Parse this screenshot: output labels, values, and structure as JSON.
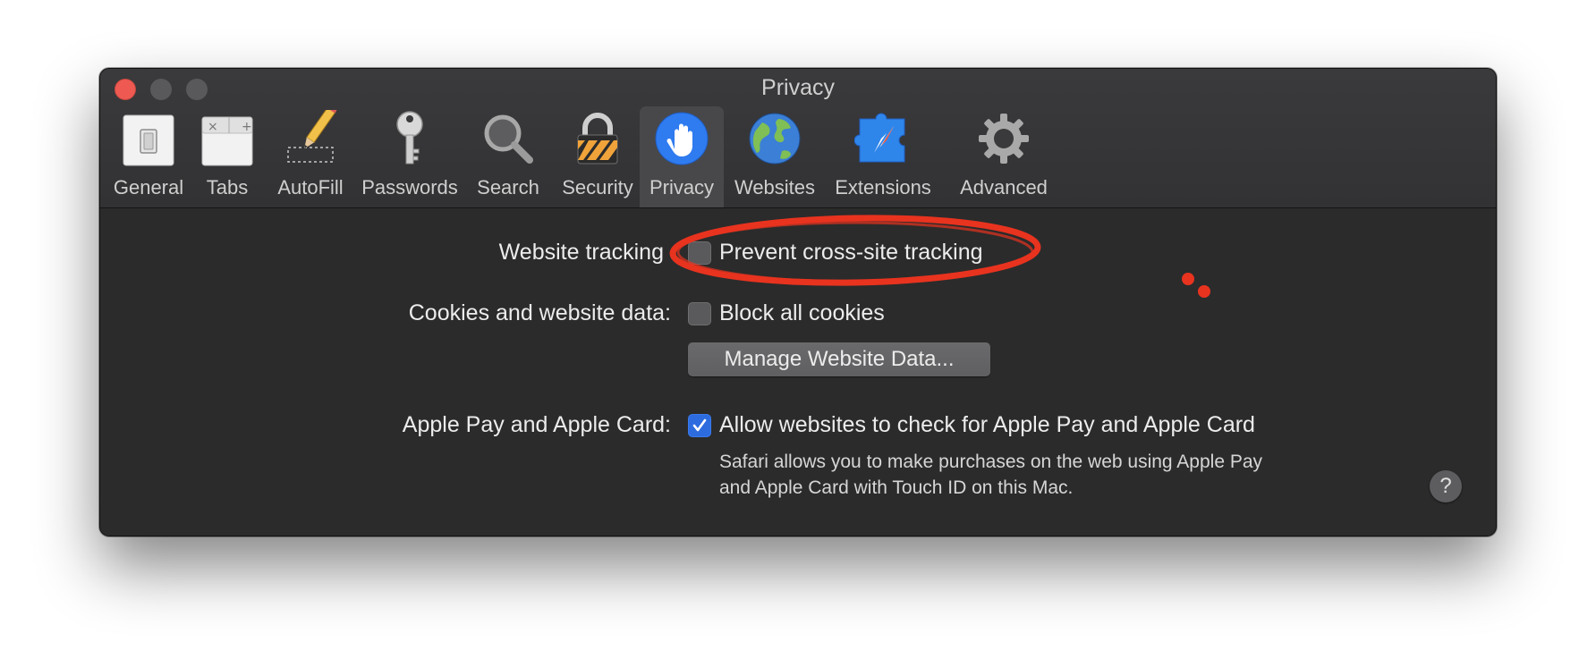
{
  "window": {
    "title": "Privacy"
  },
  "toolbar": {
    "tabs": [
      {
        "label": "General",
        "icon": "general-switch-icon"
      },
      {
        "label": "Tabs",
        "icon": "tabs-icon"
      },
      {
        "label": "AutoFill",
        "icon": "pencil-icon"
      },
      {
        "label": "Passwords",
        "icon": "key-icon"
      },
      {
        "label": "Search",
        "icon": "magnifier-icon"
      },
      {
        "label": "Security",
        "icon": "padlock-icon"
      },
      {
        "label": "Privacy",
        "icon": "hand-icon",
        "selected": true
      },
      {
        "label": "Websites",
        "icon": "globe-icon"
      },
      {
        "label": "Extensions",
        "icon": "puzzle-compass-icon"
      },
      {
        "label": "Advanced",
        "icon": "gear-icon"
      }
    ]
  },
  "tracking": {
    "label": "Website tracking",
    "option": "Prevent cross-site tracking",
    "checked": false
  },
  "cookies": {
    "label": "Cookies and website data:",
    "option": "Block all cookies",
    "checked": false,
    "button": "Manage Website Data..."
  },
  "applepay": {
    "label": "Apple Pay and Apple Card:",
    "option": "Allow websites to check for Apple Pay and Apple Card",
    "checked": true,
    "description_line1": "Safari allows you to make purchases on the web using Apple Pay",
    "description_line2": "and Apple Card with Touch ID on this Mac."
  },
  "help": {
    "label": "?"
  },
  "colors": {
    "window_bg": "#2b2b2b",
    "toolbar_bg": "#3a3a3c",
    "accent": "#2d6cdf",
    "annotation": "#e8331f"
  }
}
